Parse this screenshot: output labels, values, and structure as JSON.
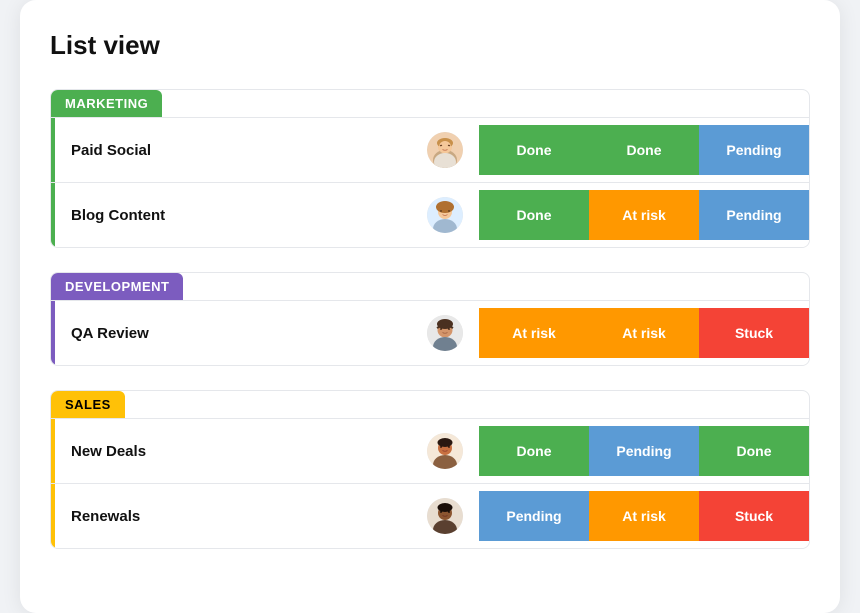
{
  "title": "List view",
  "groups": [
    {
      "id": "marketing",
      "label": "MARKETING",
      "theme": "marketing",
      "rows": [
        {
          "name": "Paid Social",
          "avatar": "woman1",
          "statuses": [
            {
              "label": "Done",
              "type": "done"
            },
            {
              "label": "Done",
              "type": "done"
            },
            {
              "label": "Pending",
              "type": "pending"
            }
          ]
        },
        {
          "name": "Blog Content",
          "avatar": "woman2",
          "statuses": [
            {
              "label": "Done",
              "type": "done"
            },
            {
              "label": "At risk",
              "type": "at-risk"
            },
            {
              "label": "Pending",
              "type": "pending"
            }
          ]
        }
      ]
    },
    {
      "id": "development",
      "label": "DEVELOPMENT",
      "theme": "development",
      "rows": [
        {
          "name": "QA Review",
          "avatar": "man1",
          "statuses": [
            {
              "label": "At risk",
              "type": "at-risk"
            },
            {
              "label": "At risk",
              "type": "at-risk"
            },
            {
              "label": "Stuck",
              "type": "stuck"
            }
          ]
        }
      ]
    },
    {
      "id": "sales",
      "label": "SALES",
      "theme": "sales",
      "rows": [
        {
          "name": "New Deals",
          "avatar": "man2",
          "statuses": [
            {
              "label": "Done",
              "type": "done"
            },
            {
              "label": "Pending",
              "type": "pending"
            },
            {
              "label": "Done",
              "type": "done"
            }
          ]
        },
        {
          "name": "Renewals",
          "avatar": "man3",
          "statuses": [
            {
              "label": "Pending",
              "type": "pending"
            },
            {
              "label": "At risk",
              "type": "at-risk"
            },
            {
              "label": "Stuck",
              "type": "stuck"
            }
          ]
        }
      ]
    }
  ]
}
